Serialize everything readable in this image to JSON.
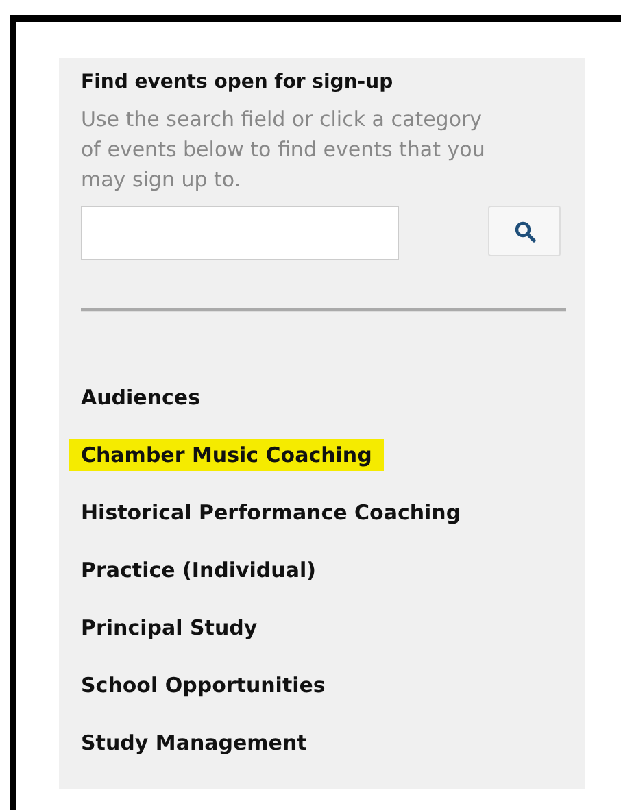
{
  "panel": {
    "title": "Find events open for sign-up",
    "description": "Use the search field or click a category of events below to find events that you may sign up to."
  },
  "categories": [
    {
      "label": "Audiences",
      "selected": false
    },
    {
      "label": "Chamber Music Coaching",
      "selected": true
    },
    {
      "label": "Historical Performance Coaching",
      "selected": false
    },
    {
      "label": "Practice (Individual)",
      "selected": false
    },
    {
      "label": "Principal Study",
      "selected": false
    },
    {
      "label": "School Opportunities",
      "selected": false
    },
    {
      "label": "Study Management",
      "selected": false
    }
  ]
}
